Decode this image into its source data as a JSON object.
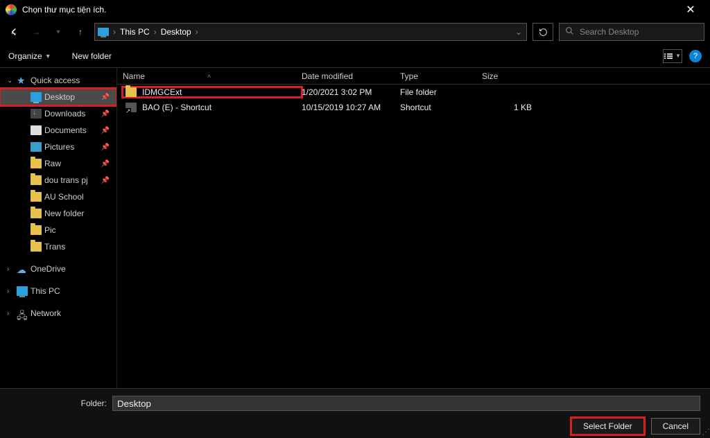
{
  "window": {
    "title": "Chọn thư mục tiện ích."
  },
  "breadcrumb": {
    "root": "This PC",
    "current": "Desktop"
  },
  "search": {
    "placeholder": "Search Desktop"
  },
  "toolbar": {
    "organize": "Organize",
    "newfolder": "New folder"
  },
  "columns": {
    "name": "Name",
    "date": "Date modified",
    "type": "Type",
    "size": "Size"
  },
  "tree": {
    "quick": "Quick access",
    "items": [
      {
        "label": "Desktop",
        "icon": "desktop",
        "pin": true,
        "sel": true,
        "hl": true
      },
      {
        "label": "Downloads",
        "icon": "down",
        "pin": true
      },
      {
        "label": "Documents",
        "icon": "doc",
        "pin": true
      },
      {
        "label": "Pictures",
        "icon": "pic",
        "pin": true
      },
      {
        "label": "Raw",
        "icon": "folder",
        "pin": true
      },
      {
        "label": "dou trans pj",
        "icon": "folder",
        "pin": true
      },
      {
        "label": "AU School",
        "icon": "folder"
      },
      {
        "label": "New folder",
        "icon": "folder"
      },
      {
        "label": "Pic",
        "icon": "folder"
      },
      {
        "label": "Trans",
        "icon": "folder"
      }
    ],
    "onedrive": "OneDrive",
    "thispc": "This PC",
    "network": "Network"
  },
  "files": [
    {
      "name": "IDMGCExt",
      "date": "1/20/2021 3:02 PM",
      "type": "File folder",
      "size": "",
      "icon": "folder",
      "hl": true
    },
    {
      "name": "BAO (E) - Shortcut",
      "date": "10/15/2019 10:27 AM",
      "type": "Shortcut",
      "size": "1 KB",
      "icon": "shortcut"
    }
  ],
  "footer": {
    "label": "Folder:",
    "value": "Desktop",
    "select": "Select Folder",
    "cancel": "Cancel"
  }
}
